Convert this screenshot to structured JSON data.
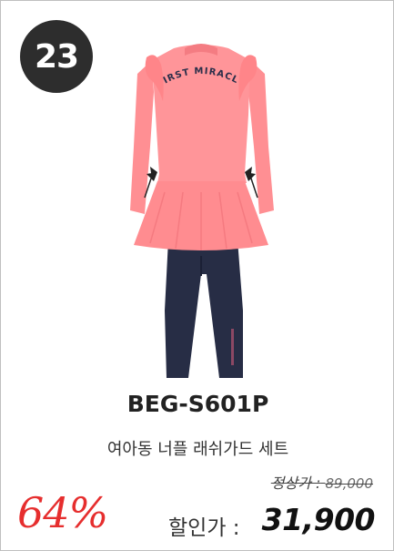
{
  "badge": {
    "rank": "23"
  },
  "product": {
    "print_text": "FIRST MIRACLE",
    "code": "BEG-S601P",
    "name": "여아동 너플 래쉬가드 세트"
  },
  "pricing": {
    "regular_label": "정상가 :",
    "regular_amount": "89,000",
    "discount_rate": "64%",
    "sale_label": "할인가 :",
    "sale_amount": "31,900"
  },
  "colors": {
    "top": "#ff8f93",
    "leggings": "#272d45",
    "discount": "#e62e2e",
    "badge": "#2d2d2d"
  }
}
